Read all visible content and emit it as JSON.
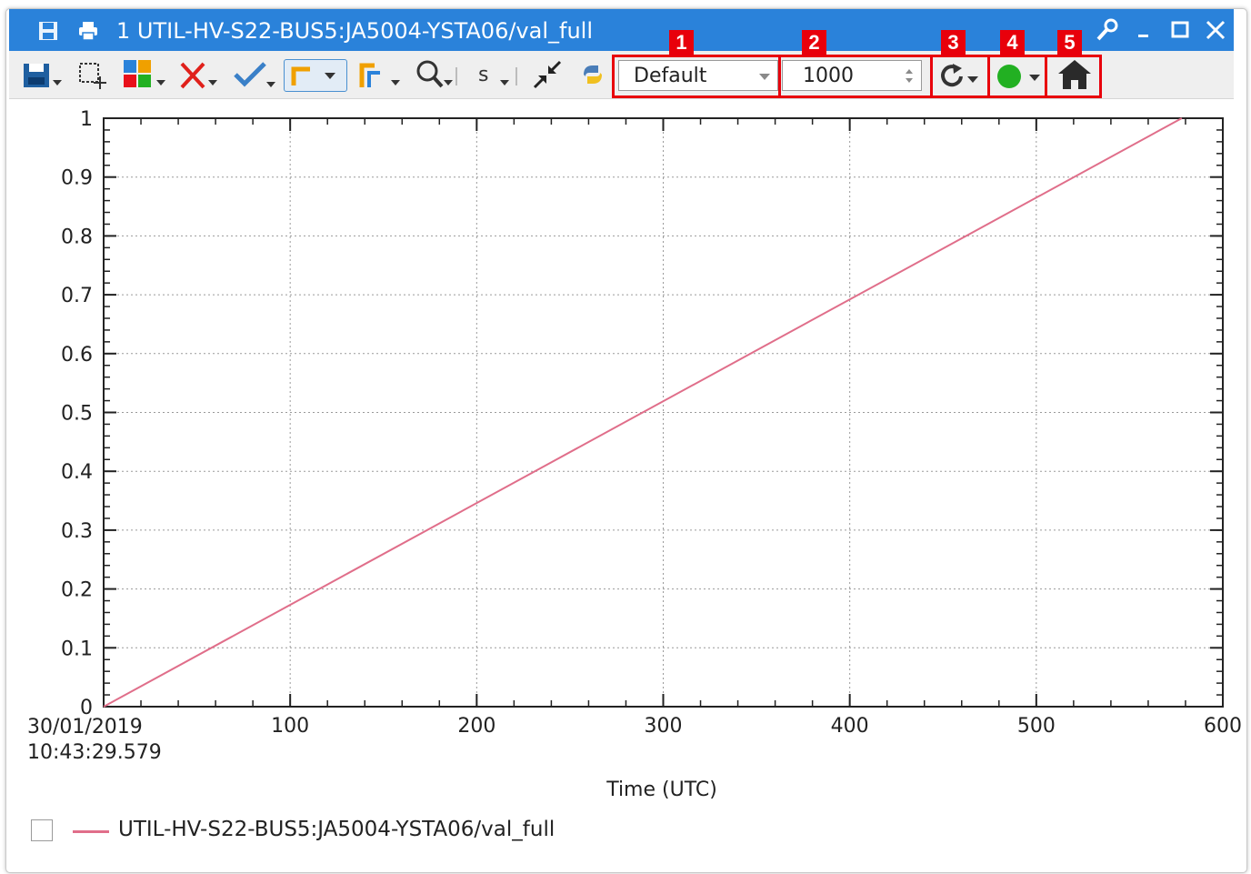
{
  "window": {
    "title": "1 UTIL-HV-S22-BUS5:JA5004-YSTA06/val_full",
    "accent_color": "#2a82da"
  },
  "titlebar_icons": [
    "save-icon",
    "print-icon"
  ],
  "window_buttons": [
    "configure-icon",
    "minimize-icon",
    "maximize-icon",
    "close-icon"
  ],
  "toolbar": {
    "buttons": [
      "save-dropdown-icon",
      "zoom-selection-icon",
      "color-grid-icon",
      "remove-curve-icon",
      "apply-check-icon",
      "plot-mode-icon",
      "axis-mode-icon",
      "search-zoom-icon",
      "scale-icon",
      "collapse-icon",
      "python-icon"
    ],
    "scale_label": "s",
    "config_select": "Default",
    "buffer_size": "1000",
    "refresh_icon": "refresh-icon",
    "status_icon": "green-status-icon",
    "status_color": "#22b022",
    "home_icon": "home-icon"
  },
  "callouts": [
    "1",
    "2",
    "3",
    "4",
    "5"
  ],
  "chart_data": {
    "type": "line",
    "xlabel": "Time (UTC)",
    "ylabel": "",
    "x_start_label_date": "30/01/2019",
    "x_start_label_time": "10:43:29.579",
    "x_ticks": [
      "100",
      "200",
      "300",
      "400",
      "500",
      "600"
    ],
    "y_ticks": [
      "0",
      "0.1",
      "0.2",
      "0.3",
      "0.4",
      "0.5",
      "0.6",
      "0.7",
      "0.8",
      "0.9",
      "1"
    ],
    "xlim": [
      0,
      600
    ],
    "ylim": [
      0,
      1
    ],
    "grid": true,
    "series": [
      {
        "name": "UTIL-HV-S22-BUS5:JA5004-YSTA06/val_full",
        "color": "#e06e8a",
        "x": [
          0,
          578
        ],
        "y": [
          0,
          1
        ]
      }
    ],
    "legend_position": "bottom-left"
  }
}
